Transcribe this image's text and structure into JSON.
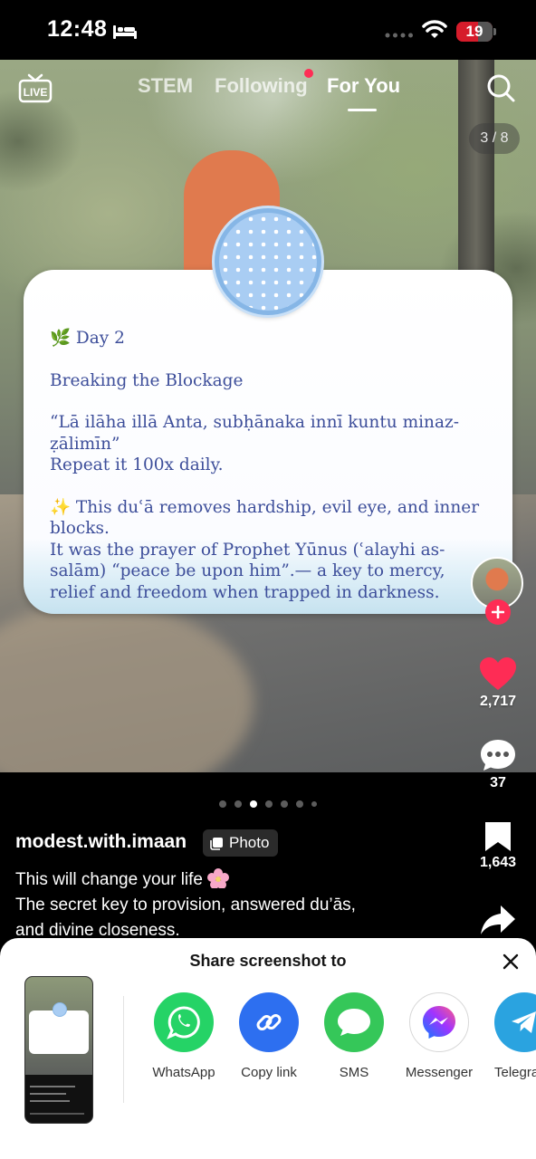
{
  "status_bar": {
    "time": "12:48",
    "battery": "19",
    "icons": [
      "bed-icon",
      "signal-dots-icon",
      "wifi-icon",
      "battery-icon"
    ]
  },
  "top_nav": {
    "live_label": "LIVE",
    "tabs": [
      {
        "label": "STEM",
        "active": false
      },
      {
        "label": "Following",
        "active": false,
        "notification_dot": true
      },
      {
        "label": "For You",
        "active": true
      }
    ]
  },
  "photo": {
    "page_counter": "3 / 8"
  },
  "card": {
    "day": "🌿 Day 2",
    "title": "Breaking the Blockage",
    "dua": "“Lā ilāha illā Anta, subḥānaka innī kuntu minaz-ẓālimīn”",
    "repeat": "Repeat it 100x daily.",
    "benefit": "✨ This duʿā removes hardship, evil eye, and inner blocks.",
    "story": "It was the prayer of Prophet Yūnus (ʿalayhi as-salām) “peace be upon him”.— a key to mercy, relief and freedom when trapped in darkness."
  },
  "actions": {
    "likes": "2,717",
    "comments": "37",
    "saves": "1,643",
    "like_color": "#fe2c55"
  },
  "carousel": {
    "total_dots": 7,
    "active_index": 2
  },
  "post": {
    "username": "modest.with.imaan",
    "type_badge": "Photo",
    "caption_line1": "This will change your life",
    "caption_line2": "The secret key to provision, answered du’ās,",
    "caption_line3": "and divine closeness."
  },
  "share_sheet": {
    "title": "Share screenshot to",
    "apps": [
      {
        "label": "WhatsApp",
        "icon": "whatsapp-icon",
        "color": "#25d366"
      },
      {
        "label": "Copy link",
        "icon": "link-icon",
        "color": "#2d6ff0"
      },
      {
        "label": "SMS",
        "icon": "sms-icon",
        "color": "#35c759"
      },
      {
        "label": "Messenger",
        "icon": "messenger-icon",
        "color": "#ffffff"
      },
      {
        "label": "Telegra",
        "icon": "telegram-icon",
        "color": "#2aa3e0"
      }
    ]
  }
}
